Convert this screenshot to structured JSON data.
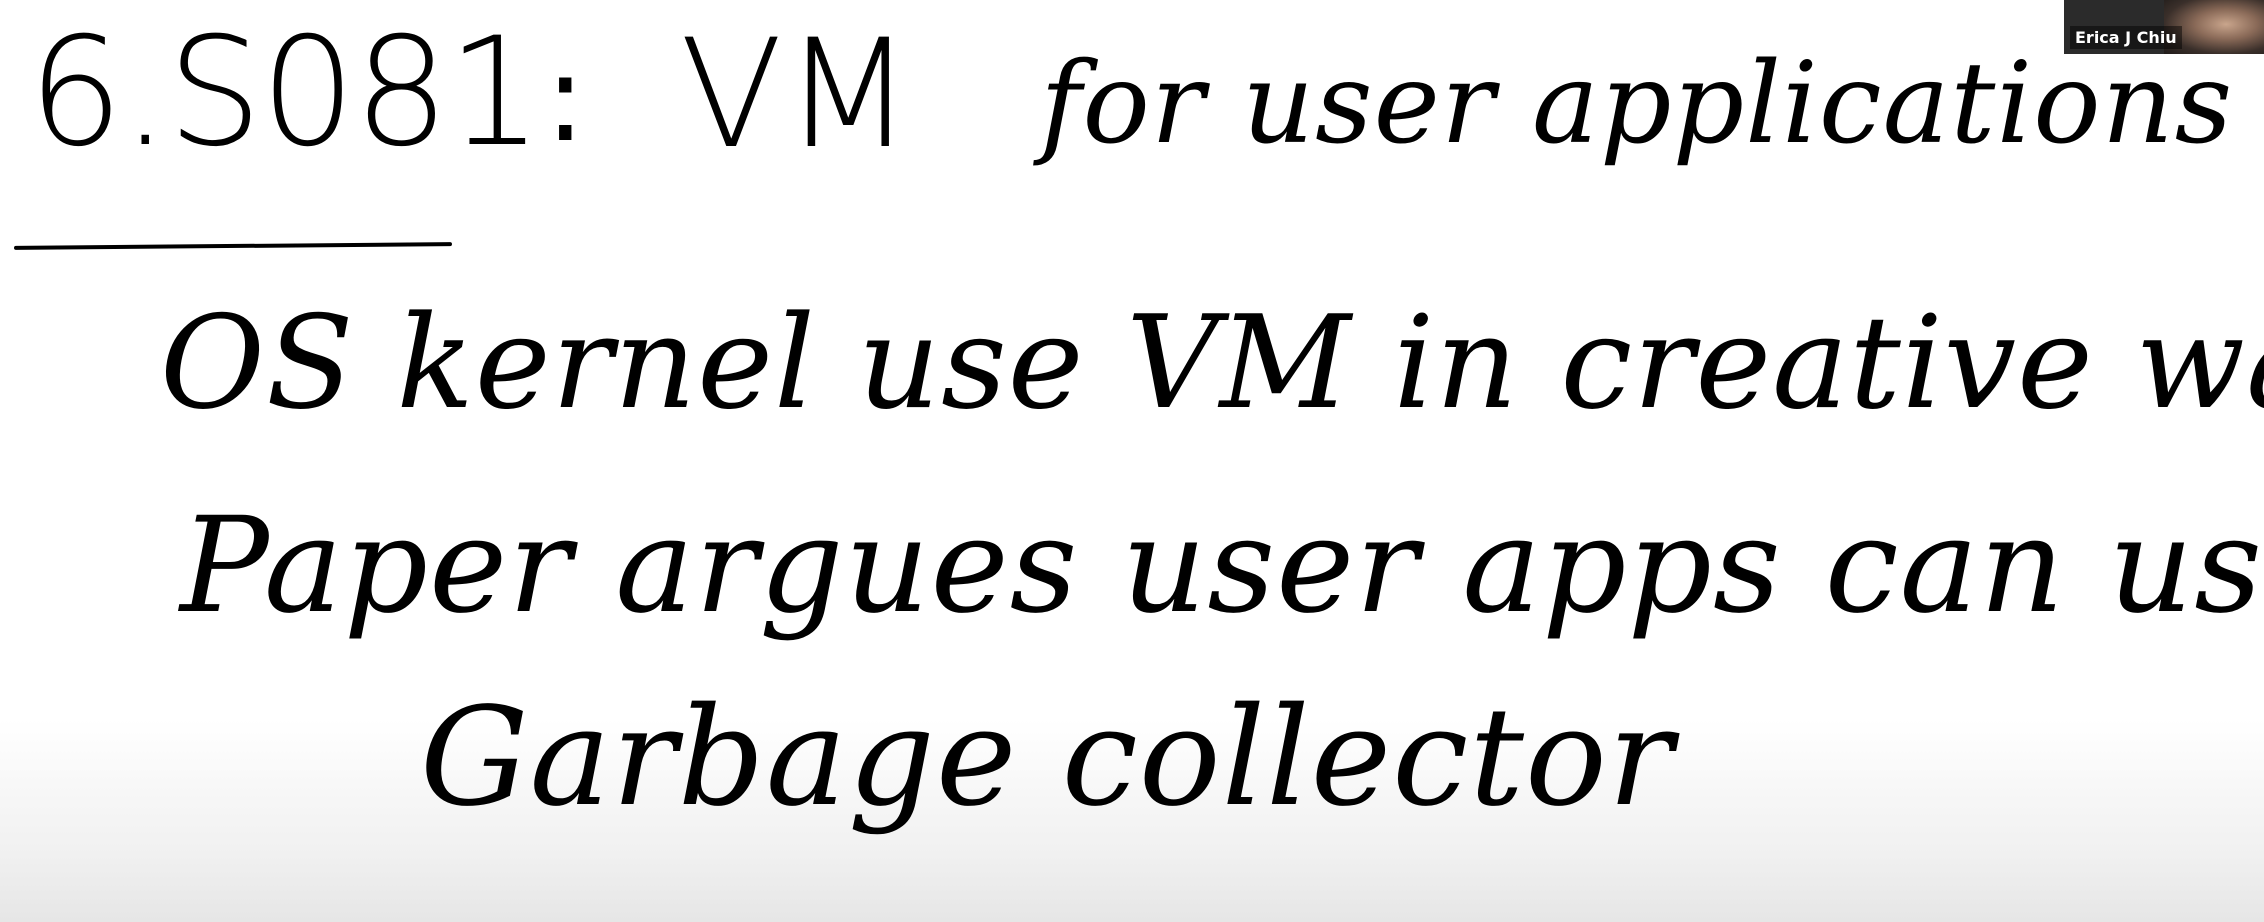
{
  "whiteboard": {
    "line1_number": "6.S081",
    "line1_colon": ":",
    "line1_vm": "VM",
    "line1_rest": "for user applications",
    "line2": "OS kernel use VM in creative ways",
    "line3": "Paper argues user apps can use VM too",
    "line4": "Garbage collector"
  },
  "participant": {
    "name": "Erica J Chiu"
  }
}
